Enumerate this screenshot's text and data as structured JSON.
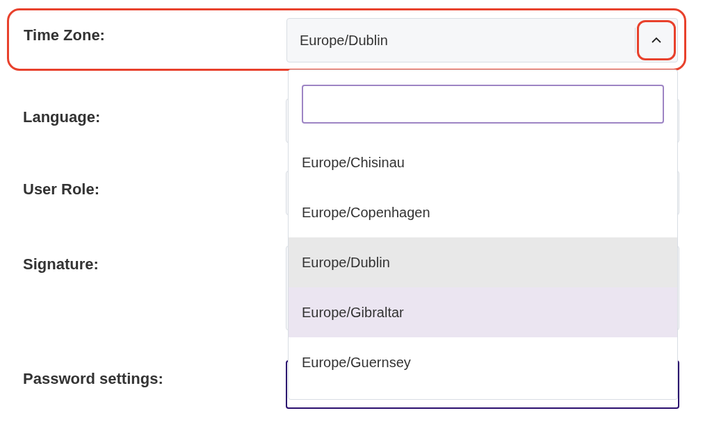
{
  "time_zone": {
    "label": "Time Zone:",
    "value": "Europe/Dublin",
    "expanded": true,
    "highlighted": true
  },
  "fields": [
    {
      "label": "Language:",
      "kind": "select"
    },
    {
      "label": "User Role:",
      "kind": "select"
    },
    {
      "label": "Signature:",
      "kind": "textarea"
    },
    {
      "label": "Password settings:",
      "kind": "focused"
    }
  ],
  "dropdown": {
    "options": [
      {
        "label": "Europe/Chisinau",
        "selected": false,
        "hovered": false
      },
      {
        "label": "Europe/Copenhagen",
        "selected": false,
        "hovered": false
      },
      {
        "label": "Europe/Dublin",
        "selected": true,
        "hovered": false
      },
      {
        "label": "Europe/Gibraltar",
        "selected": false,
        "hovered": true
      },
      {
        "label": "Europe/Guernsey",
        "selected": false,
        "hovered": false
      }
    ]
  }
}
